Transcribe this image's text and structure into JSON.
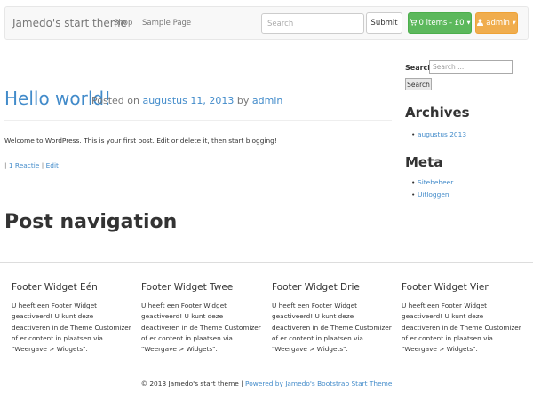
{
  "navbar": {
    "brand": "Jamedo's start theme",
    "links": [
      "Shop",
      "Sample Page"
    ],
    "search_placeholder": "Search",
    "submit_label": "Submit",
    "cart_label": "0 items - £0",
    "user_label": "admin"
  },
  "post": {
    "title": "Hello world!",
    "posted_on": "Posted on",
    "date": "augustus 11, 2013",
    "by": "by",
    "author": "admin",
    "body": "Welcome to WordPress. This is your first post. Edit or delete it, then start blogging!",
    "sep1": "|",
    "reply_link": "1 Reactie",
    "sep2": "|",
    "edit_link": "Edit"
  },
  "post_navigation": "Post navigation",
  "sidebar": {
    "search_label": "Search",
    "search_placeholder": "Search ...",
    "search_button": "Search",
    "archives_title": "Archives",
    "archives": [
      "augustus 2013"
    ],
    "meta_title": "Meta",
    "meta_links": [
      "Sitebeheer",
      "Uitloggen"
    ]
  },
  "footer": {
    "widgets": [
      {
        "title": "Footer Widget Eén",
        "text": "U heeft een Footer Widget geactiveerd! U kunt deze deactiveren in de Theme Customizer of er content in plaatsen via \"Weergave > Widgets\"."
      },
      {
        "title": "Footer Widget Twee",
        "text": "U heeft een Footer Widget geactiveerd! U kunt deze deactiveren in de Theme Customizer of er content in plaatsen via \"Weergave > Widgets\"."
      },
      {
        "title": "Footer Widget Drie",
        "text": "U heeft een Footer Widget geactiveerd! U kunt deze deactiveren in de Theme Customizer of er content in plaatsen via \"Weergave > Widgets\"."
      },
      {
        "title": "Footer Widget Vier",
        "text": "U heeft een Footer Widget geactiveerd! U kunt deze deactiveren in de Theme Customizer of er content in plaatsen via \"Weergave > Widgets\"."
      }
    ],
    "copyright": "© 2013 Jamedo's start theme |",
    "powered_by": "Powered by Jamedo's Bootstrap Start Theme"
  },
  "colors": {
    "link": "#428bca",
    "cart_button": "#5cb85c",
    "user_button": "#f0ad4e"
  },
  "icons": {
    "cart": "shopping-cart-icon",
    "user": "user-icon",
    "caret": "caret-down-icon"
  }
}
